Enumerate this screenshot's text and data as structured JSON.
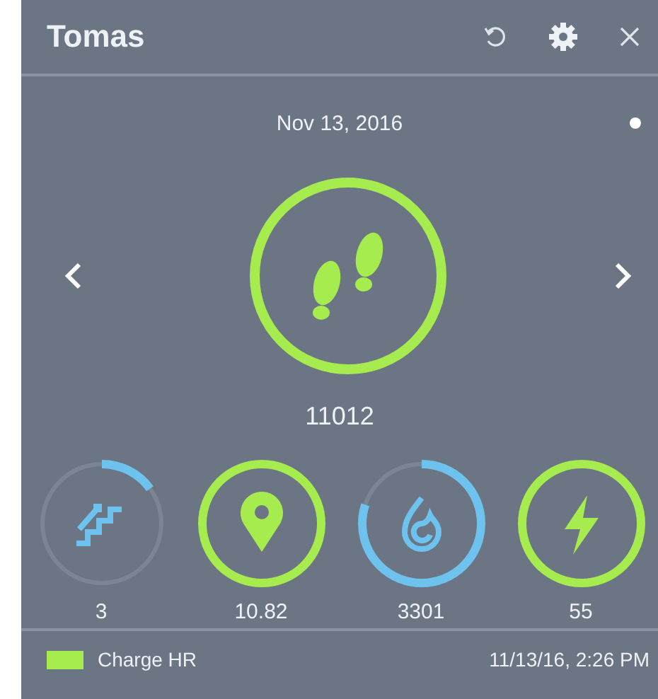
{
  "header": {
    "title": "Tomas"
  },
  "date": "Nov 13, 2016",
  "main_metric": {
    "kind": "steps",
    "value": "11012",
    "level": 1
  },
  "metrics": [
    {
      "kind": "stairs",
      "value": "3",
      "level": 0.15
    },
    {
      "kind": "distance",
      "value": "10.82",
      "level": 1
    },
    {
      "kind": "calories",
      "value": "3301",
      "level": 0.8
    },
    {
      "kind": "active",
      "value": "55",
      "level": 1
    }
  ],
  "footer": {
    "device": "Charge HR",
    "synced": "11/13/16, 2:26 PM"
  }
}
